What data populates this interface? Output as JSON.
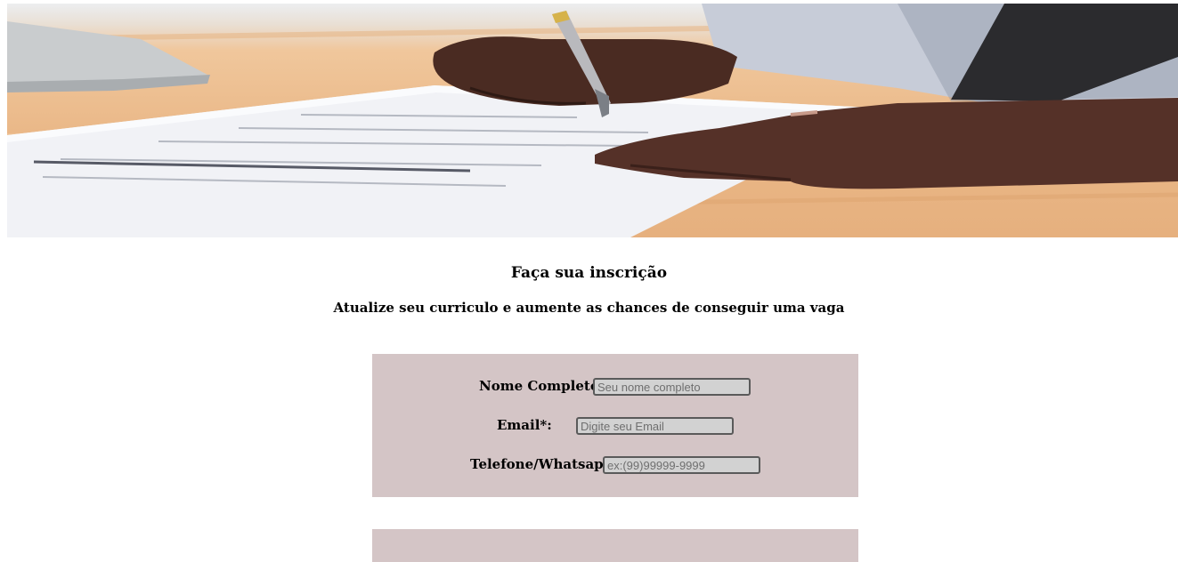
{
  "hero": {
    "image_icon": "signing-contract-photo"
  },
  "heading": {
    "title": "Faça sua inscrição",
    "subtitle": "Atualize seu curriculo e aumente as chances de conseguir uma vaga"
  },
  "form": {
    "fields": [
      {
        "label": "Nome Completo*:",
        "placeholder": "Seu nome completo",
        "value": ""
      },
      {
        "label": "Email*:",
        "placeholder": "Digite seu Email",
        "value": ""
      },
      {
        "label": "Telefone/Whatsapp*:",
        "placeholder": "ex:(99)99999-9999",
        "value": ""
      }
    ]
  },
  "colors": {
    "panel_background": "#d4c5c6",
    "input_background": "#d2d2d2",
    "input_border": "#5a5a5a"
  }
}
